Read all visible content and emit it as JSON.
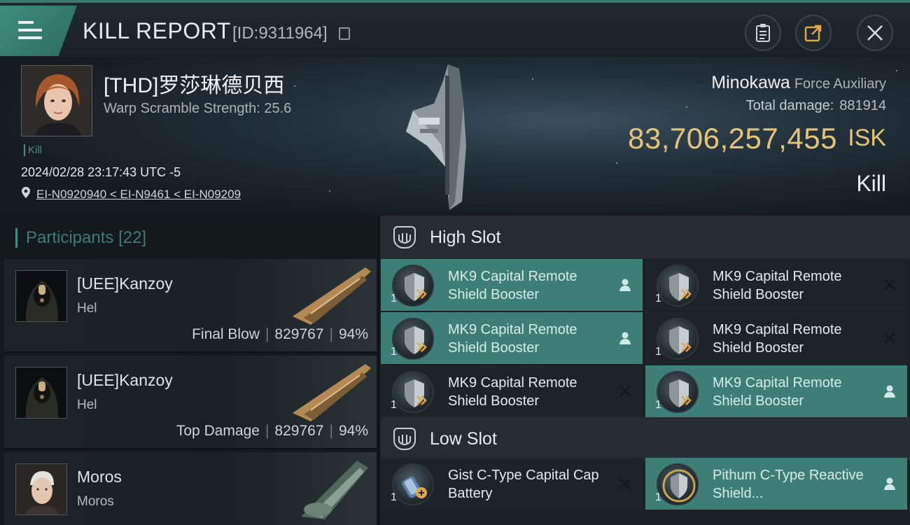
{
  "header": {
    "title": "KILL REPORT",
    "report_id": "[ID:9311964]"
  },
  "victim": {
    "name": "[THD]罗莎琳德贝西",
    "warp_scramble": "Warp Scramble Strength: 25.6",
    "kill_tag": "Kill",
    "timestamp": "2024/02/28 23:17:43 UTC -5",
    "location": "EI-N0920940 < EI-N9461 < EI-N09209",
    "ship": "Minokawa",
    "ship_class": "Force Auxiliary",
    "total_damage_label": "Total damage:",
    "total_damage": "881914",
    "isk_value": "83,706,257,455",
    "isk_unit": "ISK",
    "result": "Kill"
  },
  "participants": {
    "label": "Participants",
    "count": "[22]",
    "rows": [
      {
        "name": "[UEE]Kanzoy",
        "ship": "Hel",
        "role": "Final Blow",
        "damage": "829767",
        "percent": "94%"
      },
      {
        "name": "[UEE]Kanzoy",
        "ship": "Hel",
        "role": "Top Damage",
        "damage": "829767",
        "percent": "94%"
      },
      {
        "name": "Moros",
        "ship": "Moros",
        "role": "",
        "damage": "",
        "percent": ""
      }
    ]
  },
  "fitting": {
    "high_slot_label": "High Slot",
    "low_slot_label": "Low Slot",
    "high_slots": [
      {
        "name": "MK9 Capital Remote Shield Booster",
        "qty": "1",
        "state": "fitted"
      },
      {
        "name": "MK9 Capital Remote Shield Booster",
        "qty": "1",
        "state": "destroyed"
      },
      {
        "name": "MK9 Capital Remote Shield Booster",
        "qty": "1",
        "state": "fitted"
      },
      {
        "name": "MK9 Capital Remote Shield Booster",
        "qty": "1",
        "state": "destroyed"
      },
      {
        "name": "MK9 Capital Remote Shield Booster",
        "qty": "1",
        "state": "destroyed"
      },
      {
        "name": "MK9 Capital Remote Shield Booster",
        "qty": "1",
        "state": "fitted"
      }
    ],
    "low_slots": [
      {
        "name": "Gist C-Type Capital Cap Battery",
        "qty": "1",
        "state": "destroyed"
      },
      {
        "name": "Pithum C-Type Reactive Shield...",
        "qty": "1",
        "state": "fitted"
      }
    ]
  },
  "colors": {
    "accent": "#3f8d7f",
    "isk": "#e8c477",
    "fitted_bg": "#3d7f76"
  },
  "icons": {
    "menu": "hamburger-icon",
    "clipboard": "clipboard-icon",
    "share": "share-icon",
    "close": "close-icon",
    "location": "location-pin-icon",
    "dropped": "person-icon",
    "destroyed": "x-icon"
  }
}
